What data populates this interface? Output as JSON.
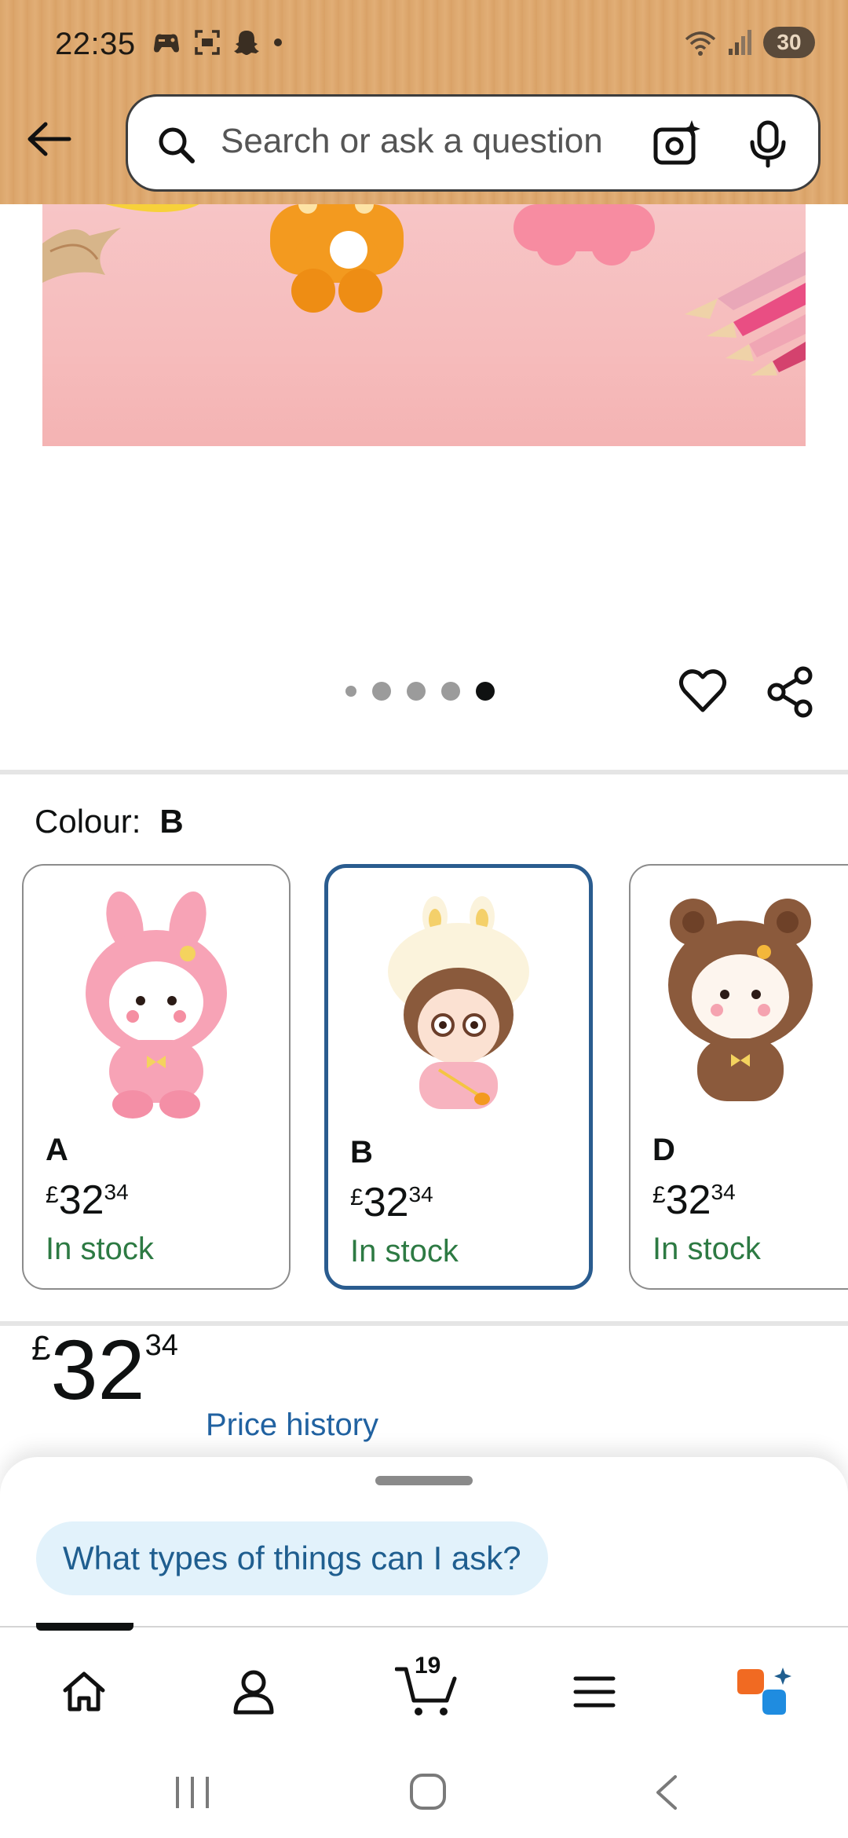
{
  "status_bar": {
    "time": "22:35",
    "battery": "30",
    "left_icons": [
      "gamepad-icon",
      "screenshot-icon",
      "snapchat-icon",
      "dot-icon"
    ],
    "right_icons": [
      "wifi-icon",
      "signal-icon"
    ]
  },
  "search": {
    "placeholder": "Search or ask a question"
  },
  "carousel": {
    "total_images": 5,
    "active_index": 4
  },
  "colour": {
    "label": "Colour:",
    "selected": "B"
  },
  "variants": [
    {
      "name": "A",
      "currency": "£",
      "price_whole": "32",
      "price_fraction": "34",
      "stock": "In stock",
      "selected": false
    },
    {
      "name": "B",
      "currency": "£",
      "price_whole": "32",
      "price_fraction": "34",
      "stock": "In stock",
      "selected": true
    },
    {
      "name": "D",
      "currency": "£",
      "price_whole": "32",
      "price_fraction": "34",
      "stock": "In stock",
      "selected": false
    }
  ],
  "price": {
    "currency": "£",
    "whole": "32",
    "fraction": "34",
    "history_link": "Price history"
  },
  "assistant": {
    "suggestion": "What types of things can I ask?"
  },
  "bottom_nav": {
    "items": [
      "home-icon",
      "account-icon",
      "cart-icon",
      "menu-icon",
      "rufus-icon"
    ],
    "cart_count": "19",
    "active": "home-icon"
  },
  "colors": {
    "header": "#dba56b",
    "selected_border": "#2a5c8f",
    "in_stock": "#2d7a43",
    "link": "#2162a1",
    "chip_bg": "#e2f2fb"
  }
}
